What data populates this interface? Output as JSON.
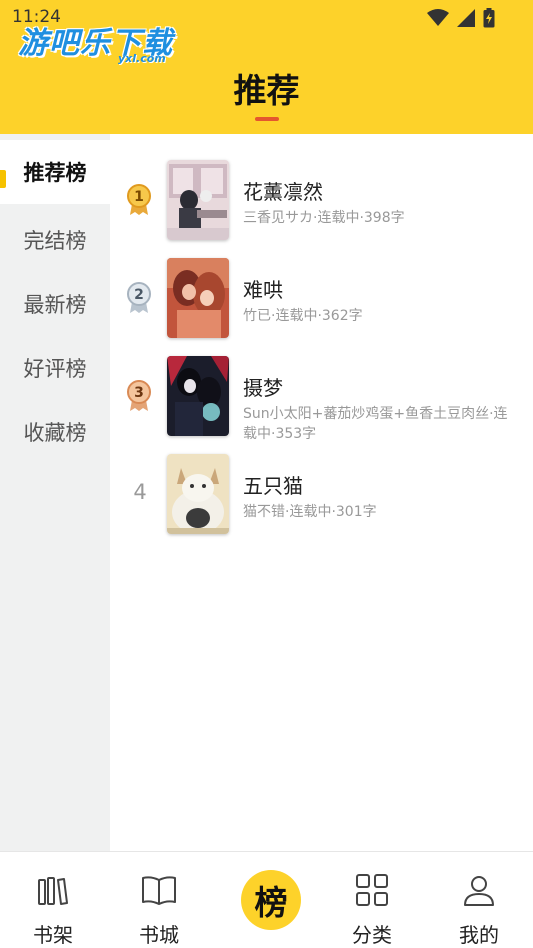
{
  "status_bar": {
    "time": "11:24",
    "icons": [
      "wifi-icon",
      "cellular-signal-icon",
      "battery-charging-icon"
    ]
  },
  "watermark": {
    "text": "游吧乐下载",
    "sub": "yxl.com"
  },
  "header": {
    "title": "推荐",
    "background": "#FDD22A",
    "underline_color": "#E4572E"
  },
  "left_nav": {
    "items": [
      {
        "label": "推荐榜",
        "active": true
      },
      {
        "label": "完结榜",
        "active": false
      },
      {
        "label": "最新榜",
        "active": false
      },
      {
        "label": "好评榜",
        "active": false
      },
      {
        "label": "收藏榜",
        "active": false
      }
    ]
  },
  "rank_list": {
    "items": [
      {
        "rank": "1",
        "badge": "gold-medal-icon",
        "title": "花薰凛然",
        "meta": "三香见サカ·连载中·398字"
      },
      {
        "rank": "2",
        "badge": "silver-medal-icon",
        "title": "难哄",
        "meta": "竹已·连载中·362字"
      },
      {
        "rank": "3",
        "badge": "bronze-medal-icon",
        "title": "摄梦",
        "meta": "Sun小太阳+蕃茄炒鸡蛋+鱼香土豆肉丝·连载中·353字"
      },
      {
        "rank": "4",
        "badge": "",
        "title": "五只猫",
        "meta": "猫不错·连载中·301字"
      }
    ]
  },
  "tabbar": {
    "tabs": [
      {
        "label": "书架",
        "icon": "bookshelf-icon"
      },
      {
        "label": "书城",
        "icon": "open-book-icon"
      },
      {
        "label": "榜",
        "icon": "ranking-button"
      },
      {
        "label": "分类",
        "icon": "grid-category-icon"
      },
      {
        "label": "我的",
        "icon": "user-profile-icon"
      }
    ]
  }
}
